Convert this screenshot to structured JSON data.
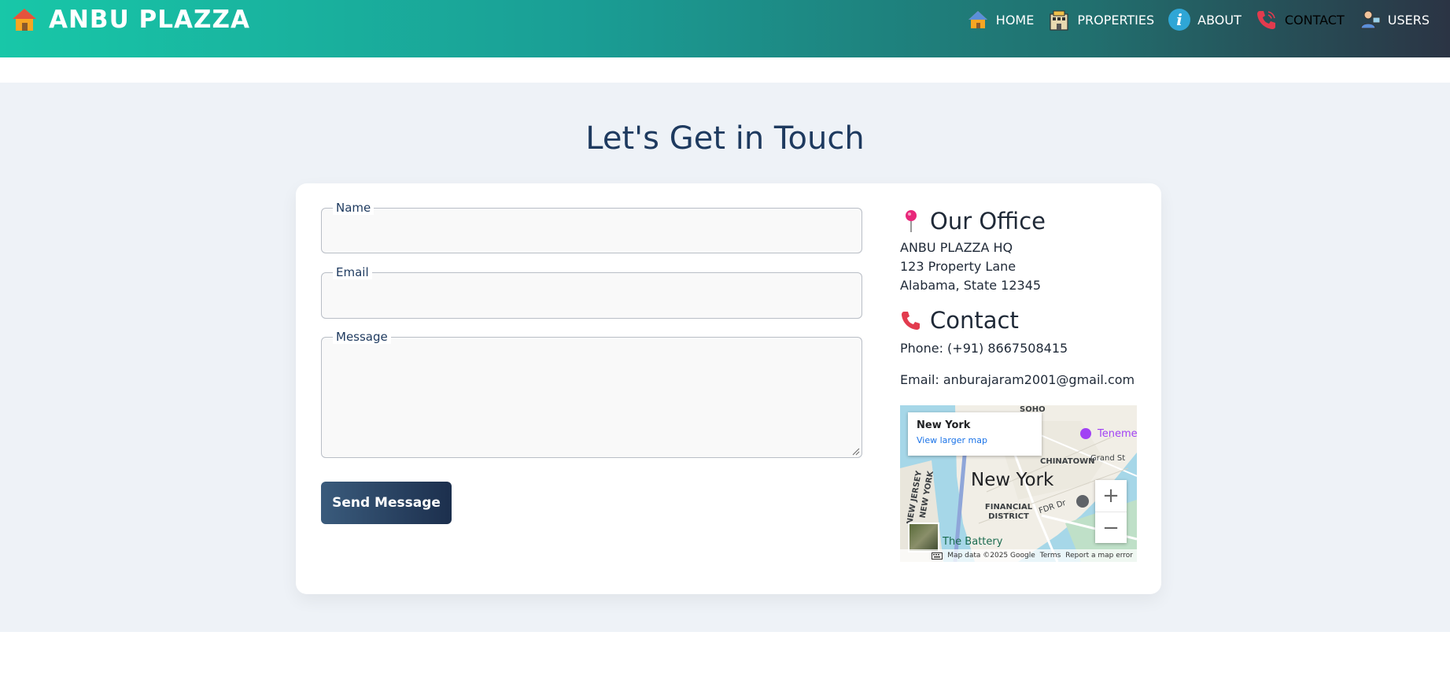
{
  "brand": {
    "name": "ANBU PLAZZA",
    "icon": "house-icon"
  },
  "nav": [
    {
      "label": "HOME",
      "icon": "house-icon",
      "active": false
    },
    {
      "label": "PROPERTIES",
      "icon": "building-icon",
      "active": false
    },
    {
      "label": "ABOUT",
      "icon": "info-icon",
      "active": false
    },
    {
      "label": "CONTACT",
      "icon": "phone-icon",
      "active": true
    },
    {
      "label": "USERS",
      "icon": "user-icon",
      "active": false
    }
  ],
  "page": {
    "title": "Let's Get in Touch"
  },
  "form": {
    "name_label": "Name",
    "name_value": "",
    "email_label": "Email",
    "email_value": "",
    "message_label": "Message",
    "message_value": "",
    "submit_label": "Send Message"
  },
  "office": {
    "heading": "Our Office",
    "icon": "pin-icon",
    "lines": [
      "ANBU PLAZZA HQ",
      "123 Property Lane",
      "Alabama, State 12345"
    ]
  },
  "contact": {
    "heading": "Contact",
    "icon": "phone-icon",
    "phone": "Phone: (+91) 8667508415",
    "email": "Email: anburajaram2001@gmail.com"
  },
  "map": {
    "popup_title": "New York",
    "popup_link": "View larger map",
    "city_label": "New York",
    "labels": [
      "SOHO",
      "CHINATOWN",
      "Grand St",
      "FINANCIAL DISTRICT",
      "NEW JERSEY",
      "NEW YORK",
      "The Battery",
      "FDR Dr",
      "Teneme"
    ],
    "footer": [
      "Map data ©2025 Google",
      "Terms",
      "Report a map error"
    ],
    "zoom_in": "+",
    "zoom_out": "−"
  },
  "colors": {
    "header_start": "#18c7a8",
    "header_end": "#2b3444",
    "title": "#1e3a5f",
    "button_start": "#3a5b7c",
    "button_end": "#1c2f4d",
    "section_bg": "#eef2f7"
  }
}
